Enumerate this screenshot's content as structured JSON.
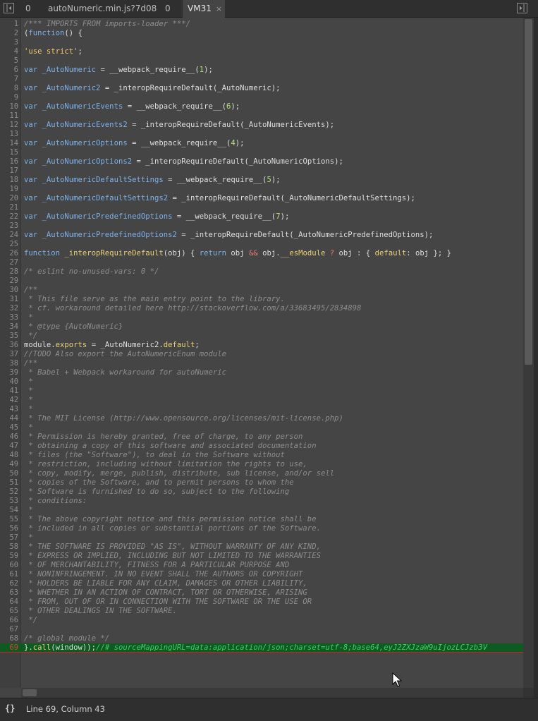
{
  "tabs": [
    {
      "label": "0"
    },
    {
      "label": "autoNumeric.min.js?7d08"
    },
    {
      "label": "0"
    },
    {
      "label": "VM31",
      "close": "×"
    }
  ],
  "status": {
    "icon": "{}",
    "position": "Line 69, Column 43"
  },
  "code_lines": [
    {
      "n": "1",
      "tokens": [
        [
          "com",
          "/*** IMPORTS FROM imports-loader ***/"
        ]
      ]
    },
    {
      "n": "2",
      "tokens": [
        [
          "def",
          "("
        ],
        [
          "kw",
          "function"
        ],
        [
          "def",
          "() {"
        ]
      ]
    },
    {
      "n": "3",
      "tokens": []
    },
    {
      "n": "4",
      "tokens": [
        [
          "str",
          "'use strict'"
        ],
        [
          "def",
          ";"
        ]
      ]
    },
    {
      "n": "5",
      "tokens": []
    },
    {
      "n": "6",
      "tokens": [
        [
          "kw",
          "var "
        ],
        [
          "var",
          "_AutoNumeric"
        ],
        [
          "def",
          " = __webpack_require__("
        ],
        [
          "num",
          "1"
        ],
        [
          "def",
          ");"
        ]
      ]
    },
    {
      "n": "7",
      "tokens": []
    },
    {
      "n": "8",
      "tokens": [
        [
          "kw",
          "var "
        ],
        [
          "var",
          "_AutoNumeric2"
        ],
        [
          "def",
          " = _interopRequireDefault(_AutoNumeric);"
        ]
      ]
    },
    {
      "n": "9",
      "tokens": []
    },
    {
      "n": "10",
      "tokens": [
        [
          "kw",
          "var "
        ],
        [
          "var",
          "_AutoNumericEvents"
        ],
        [
          "def",
          " = __webpack_require__("
        ],
        [
          "num",
          "6"
        ],
        [
          "def",
          ");"
        ]
      ]
    },
    {
      "n": "11",
      "tokens": []
    },
    {
      "n": "12",
      "tokens": [
        [
          "kw",
          "var "
        ],
        [
          "var",
          "_AutoNumericEvents2"
        ],
        [
          "def",
          " = _interopRequireDefault(_AutoNumericEvents);"
        ]
      ]
    },
    {
      "n": "13",
      "tokens": []
    },
    {
      "n": "14",
      "tokens": [
        [
          "kw",
          "var "
        ],
        [
          "var",
          "_AutoNumericOptions"
        ],
        [
          "def",
          " = __webpack_require__("
        ],
        [
          "num",
          "4"
        ],
        [
          "def",
          ");"
        ]
      ]
    },
    {
      "n": "15",
      "tokens": []
    },
    {
      "n": "16",
      "tokens": [
        [
          "kw",
          "var "
        ],
        [
          "var",
          "_AutoNumericOptions2"
        ],
        [
          "def",
          " = _interopRequireDefault(_AutoNumericOptions);"
        ]
      ]
    },
    {
      "n": "17",
      "tokens": []
    },
    {
      "n": "18",
      "tokens": [
        [
          "kw",
          "var "
        ],
        [
          "var",
          "_AutoNumericDefaultSettings"
        ],
        [
          "def",
          " = __webpack_require__("
        ],
        [
          "num",
          "5"
        ],
        [
          "def",
          ");"
        ]
      ]
    },
    {
      "n": "19",
      "tokens": []
    },
    {
      "n": "20",
      "tokens": [
        [
          "kw",
          "var "
        ],
        [
          "var",
          "_AutoNumericDefaultSettings2"
        ],
        [
          "def",
          " = _interopRequireDefault(_AutoNumericDefaultSettings);"
        ]
      ]
    },
    {
      "n": "21",
      "tokens": []
    },
    {
      "n": "22",
      "tokens": [
        [
          "kw",
          "var "
        ],
        [
          "var",
          "_AutoNumericPredefinedOptions"
        ],
        [
          "def",
          " = __webpack_require__("
        ],
        [
          "num",
          "7"
        ],
        [
          "def",
          ");"
        ]
      ]
    },
    {
      "n": "23",
      "tokens": []
    },
    {
      "n": "24",
      "tokens": [
        [
          "kw",
          "var "
        ],
        [
          "var",
          "_AutoNumericPredefinedOptions2"
        ],
        [
          "def",
          " = _interopRequireDefault(_AutoNumericPredefinedOptions);"
        ]
      ]
    },
    {
      "n": "25",
      "tokens": []
    },
    {
      "n": "26",
      "tokens": [
        [
          "kw",
          "function "
        ],
        [
          "fn",
          "_interopRequireDefault"
        ],
        [
          "def",
          "(obj) { "
        ],
        [
          "kw",
          "return"
        ],
        [
          "def",
          " obj "
        ],
        [
          "op",
          "&&"
        ],
        [
          "def",
          " obj."
        ],
        [
          "fn",
          "__esModule"
        ],
        [
          "def",
          " "
        ],
        [
          "op",
          "?"
        ],
        [
          "def",
          " obj : { "
        ],
        [
          "fn",
          "default"
        ],
        [
          "def",
          ": obj }; }"
        ]
      ]
    },
    {
      "n": "27",
      "tokens": []
    },
    {
      "n": "28",
      "tokens": [
        [
          "com",
          "/* eslint no-unused-vars: 0 */"
        ]
      ]
    },
    {
      "n": "29",
      "tokens": []
    },
    {
      "n": "30",
      "tokens": [
        [
          "com",
          "/**"
        ]
      ]
    },
    {
      "n": "31",
      "tokens": [
        [
          "com",
          " * This file serve as the main entry point to the library."
        ]
      ]
    },
    {
      "n": "32",
      "tokens": [
        [
          "com",
          " * cf. workaround detailed here http://stackoverflow.com/a/33683495/2834898"
        ]
      ]
    },
    {
      "n": "33",
      "tokens": [
        [
          "com",
          " *"
        ]
      ]
    },
    {
      "n": "34",
      "tokens": [
        [
          "com",
          " * @type {AutoNumeric}"
        ]
      ]
    },
    {
      "n": "35",
      "tokens": [
        [
          "com",
          " */"
        ]
      ]
    },
    {
      "n": "36",
      "tokens": [
        [
          "def",
          "module."
        ],
        [
          "fn",
          "exports"
        ],
        [
          "def",
          " = _AutoNumeric2."
        ],
        [
          "fn",
          "default"
        ],
        [
          "def",
          ";"
        ]
      ]
    },
    {
      "n": "37",
      "tokens": [
        [
          "com",
          "//TODO Also export the AutoNumericEnum module"
        ]
      ]
    },
    {
      "n": "38",
      "tokens": [
        [
          "com",
          "/**"
        ]
      ]
    },
    {
      "n": "39",
      "tokens": [
        [
          "com",
          " * Babel + Webpack workaround for autoNumeric"
        ]
      ]
    },
    {
      "n": "40",
      "tokens": [
        [
          "com",
          " *"
        ]
      ]
    },
    {
      "n": "41",
      "tokens": [
        [
          "com",
          " *"
        ]
      ]
    },
    {
      "n": "42",
      "tokens": [
        [
          "com",
          " *"
        ]
      ]
    },
    {
      "n": "43",
      "tokens": [
        [
          "com",
          " *"
        ]
      ]
    },
    {
      "n": "44",
      "tokens": [
        [
          "com",
          " * The MIT License (http://www.opensource.org/licenses/mit-license.php)"
        ]
      ]
    },
    {
      "n": "45",
      "tokens": [
        [
          "com",
          " *"
        ]
      ]
    },
    {
      "n": "46",
      "tokens": [
        [
          "com",
          " * Permission is hereby granted, free of charge, to any person"
        ]
      ]
    },
    {
      "n": "47",
      "tokens": [
        [
          "com",
          " * obtaining a copy of this software and associated documentation"
        ]
      ]
    },
    {
      "n": "48",
      "tokens": [
        [
          "com",
          " * files (the \"Software\"), to deal in the Software without"
        ]
      ]
    },
    {
      "n": "49",
      "tokens": [
        [
          "com",
          " * restriction, including without limitation the rights to use,"
        ]
      ]
    },
    {
      "n": "50",
      "tokens": [
        [
          "com",
          " * copy, modify, merge, publish, distribute, sub license, and/or sell"
        ]
      ]
    },
    {
      "n": "51",
      "tokens": [
        [
          "com",
          " * copies of the Software, and to permit persons to whom the"
        ]
      ]
    },
    {
      "n": "52",
      "tokens": [
        [
          "com",
          " * Software is furnished to do so, subject to the following"
        ]
      ]
    },
    {
      "n": "53",
      "tokens": [
        [
          "com",
          " * conditions:"
        ]
      ]
    },
    {
      "n": "54",
      "tokens": [
        [
          "com",
          " *"
        ]
      ]
    },
    {
      "n": "55",
      "tokens": [
        [
          "com",
          " * The above copyright notice and this permission notice shall be"
        ]
      ]
    },
    {
      "n": "56",
      "tokens": [
        [
          "com",
          " * included in all copies or substantial portions of the Software."
        ]
      ]
    },
    {
      "n": "57",
      "tokens": [
        [
          "com",
          " *"
        ]
      ]
    },
    {
      "n": "58",
      "tokens": [
        [
          "com",
          " * THE SOFTWARE IS PROVIDED \"AS IS\", WITHOUT WARRANTY OF ANY KIND,"
        ]
      ]
    },
    {
      "n": "59",
      "tokens": [
        [
          "com",
          " * EXPRESS OR IMPLIED, INCLUDING BUT NOT LIMITED TO THE WARRANTIES"
        ]
      ]
    },
    {
      "n": "60",
      "tokens": [
        [
          "com",
          " * OF MERCHANTABILITY, FITNESS FOR A PARTICULAR PURPOSE AND"
        ]
      ]
    },
    {
      "n": "61",
      "tokens": [
        [
          "com",
          " * NONINFRINGEMENT. IN NO EVENT SHALL THE AUTHORS OR COPYRIGHT"
        ]
      ]
    },
    {
      "n": "62",
      "tokens": [
        [
          "com",
          " * HOLDERS BE LIABLE FOR ANY CLAIM, DAMAGES OR OTHER LIABILITY,"
        ]
      ]
    },
    {
      "n": "63",
      "tokens": [
        [
          "com",
          " * WHETHER IN AN ACTION OF CONTRACT, TORT OR OTHERWISE, ARISING"
        ]
      ]
    },
    {
      "n": "64",
      "tokens": [
        [
          "com",
          " * FROM, OUT OF OR IN CONNECTION WITH THE SOFTWARE OR THE USE OR"
        ]
      ]
    },
    {
      "n": "65",
      "tokens": [
        [
          "com",
          " * OTHER DEALINGS IN THE SOFTWARE."
        ]
      ]
    },
    {
      "n": "66",
      "tokens": [
        [
          "com",
          " */"
        ]
      ]
    },
    {
      "n": "67",
      "tokens": []
    },
    {
      "n": "68",
      "tokens": [
        [
          "com",
          "/* global module */"
        ]
      ]
    },
    {
      "n": "69",
      "highlight": true,
      "tokens": [
        [
          "def",
          "}."
        ],
        [
          "fn",
          "call"
        ],
        [
          "def",
          "(window));"
        ],
        [
          "src",
          "//# sourceMappingURL=data:application/json;charset=utf-8;base64,eyJ2ZXJzaW9uIjozLCJzb3V"
        ]
      ]
    }
  ]
}
